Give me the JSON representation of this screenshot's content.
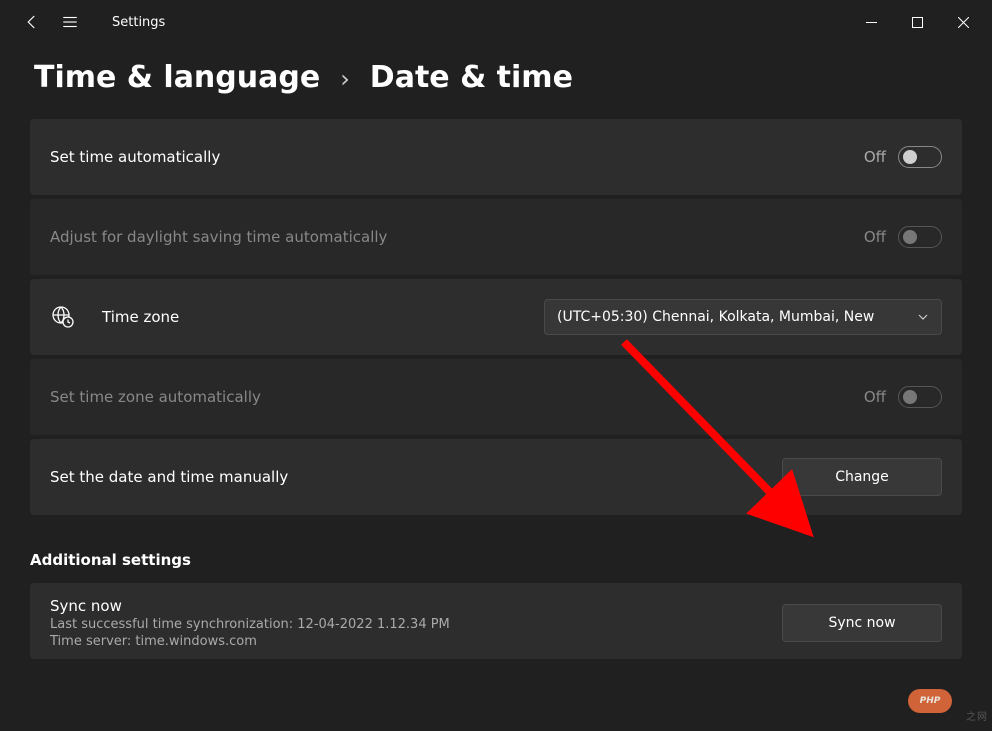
{
  "titlebar": {
    "title": "Settings"
  },
  "breadcrumb": {
    "parent": "Time & language",
    "separator": "›",
    "current": "Date & time"
  },
  "cards": {
    "auto_time": {
      "label": "Set time automatically",
      "state": "Off"
    },
    "dst": {
      "label": "Adjust for daylight saving time automatically",
      "state": "Off"
    },
    "timezone": {
      "label": "Time zone",
      "value": "(UTC+05:30) Chennai, Kolkata, Mumbai, New"
    },
    "auto_tz": {
      "label": "Set time zone automatically",
      "state": "Off"
    },
    "manual": {
      "label": "Set the date and time manually",
      "button": "Change"
    }
  },
  "section": {
    "heading": "Additional settings"
  },
  "sync": {
    "title": "Sync now",
    "last": "Last successful time synchronization: 12-04-2022 1.12.34 PM",
    "server": "Time server: time.windows.com",
    "button": "Sync now"
  },
  "watermark": {
    "badge": "PHP",
    "text": "之网"
  }
}
